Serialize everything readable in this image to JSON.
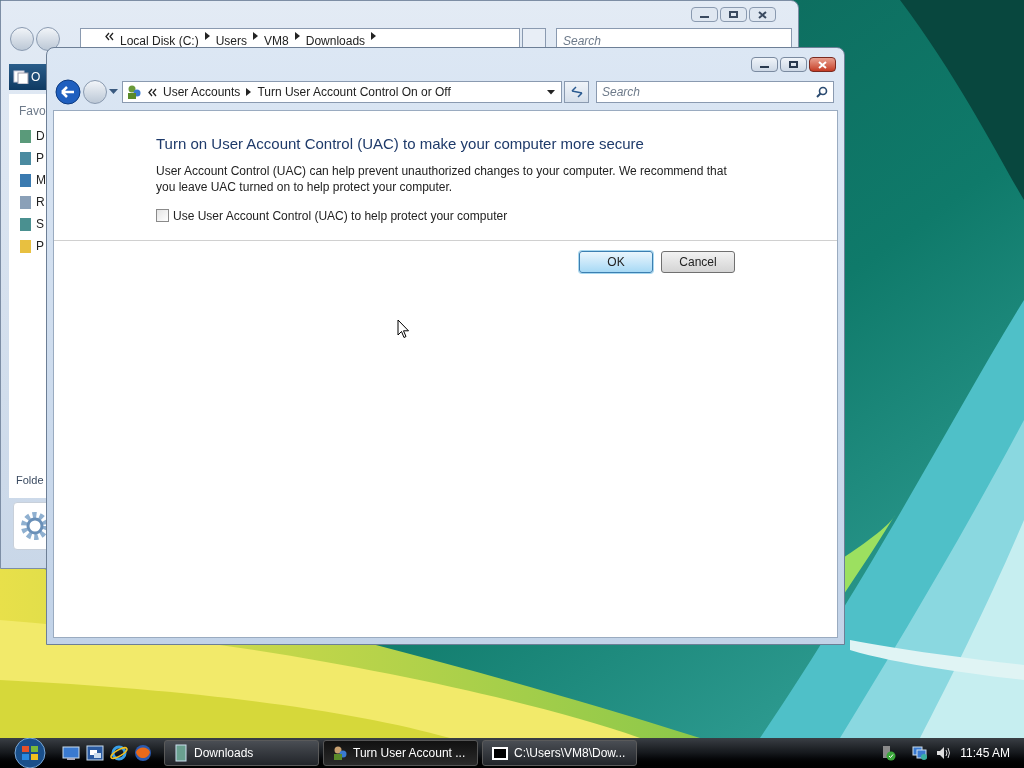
{
  "back_window": {
    "address": [
      "Local Disk (C:)",
      "Users",
      "VM8",
      "Downloads"
    ],
    "search_placeholder": "Search",
    "toolbar_label": "O",
    "pane_header": "Favo",
    "links": [
      "D",
      "P",
      "M",
      "R",
      "S",
      "P"
    ],
    "folders_label": "Folde"
  },
  "window": {
    "address": [
      "User Accounts",
      "Turn User Account Control On or Off"
    ],
    "search_placeholder": "Search",
    "heading": "Turn on User Account Control (UAC) to make your computer more secure",
    "description": "User Account Control (UAC) can help prevent unauthorized changes to your computer.  We recommend that you leave UAC turned on to help protect your computer.",
    "checkbox": {
      "label": "Use User Account Control (UAC) to help protect your computer",
      "checked": false
    },
    "buttons": [
      {
        "label": "OK",
        "default": true
      },
      {
        "label": "Cancel",
        "default": false
      }
    ]
  },
  "taskbar": {
    "tasks": [
      {
        "label": "Downloads",
        "selected": false
      },
      {
        "label": "Turn User Account ...",
        "selected": true
      },
      {
        "label": "C:\\Users\\VM8\\Dow...",
        "selected": false
      }
    ],
    "clock": "11:45 AM"
  }
}
